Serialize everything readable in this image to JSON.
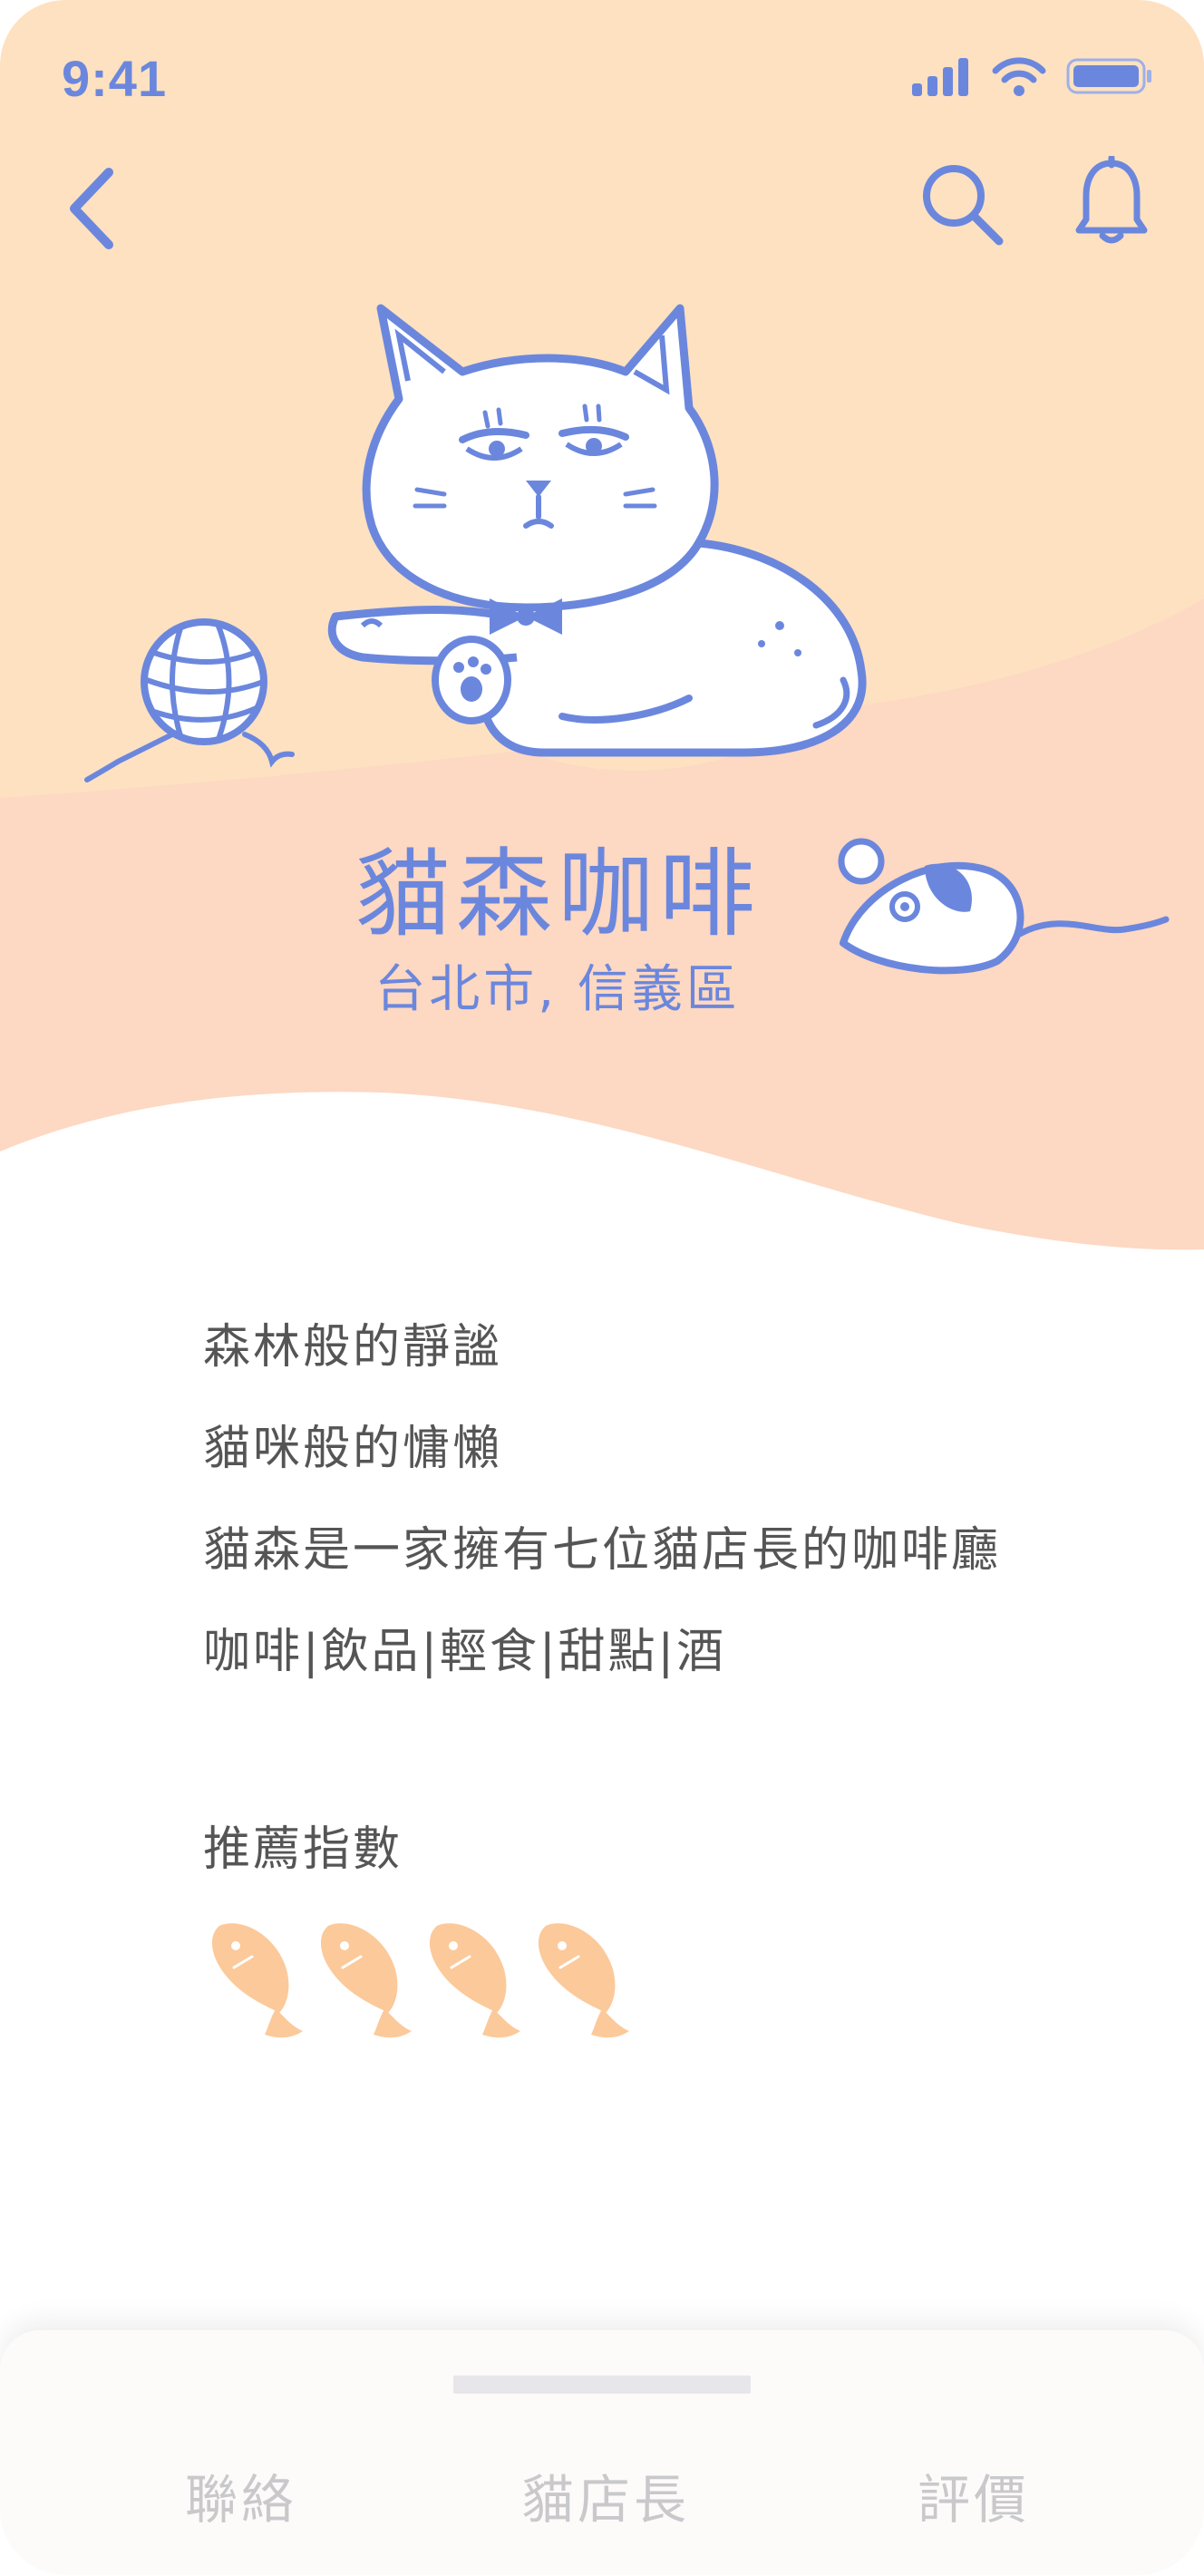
{
  "status_bar": {
    "time": "9:41"
  },
  "nav": {
    "back_icon": "chevron-left",
    "search_icon": "magnifier",
    "notification_icon": "bell"
  },
  "hero": {
    "title": "貓森咖啡",
    "subtitle": "台北市, 信義區",
    "illustrations": [
      "cat-with-bowtie",
      "yarn-ball",
      "toy-mouse"
    ]
  },
  "description": {
    "lines": [
      "森林般的靜謐",
      "貓咪般的慵懶",
      "貓森是一家擁有七位貓店長的咖啡廳",
      "咖啡|飲品|輕食|甜點|酒"
    ]
  },
  "rating": {
    "label": "推薦指數",
    "value": 4,
    "icon": "fish"
  },
  "bottom_sheet": {
    "tabs": [
      "聯絡",
      "貓店長",
      "評價"
    ]
  },
  "colors": {
    "accent": "#6b87dd",
    "hero_top": "#fde1c1",
    "hero_bottom": "#fdd8c2",
    "fish": "#fcc99a",
    "text": "#555555",
    "tab_text": "#c9c9cc"
  }
}
